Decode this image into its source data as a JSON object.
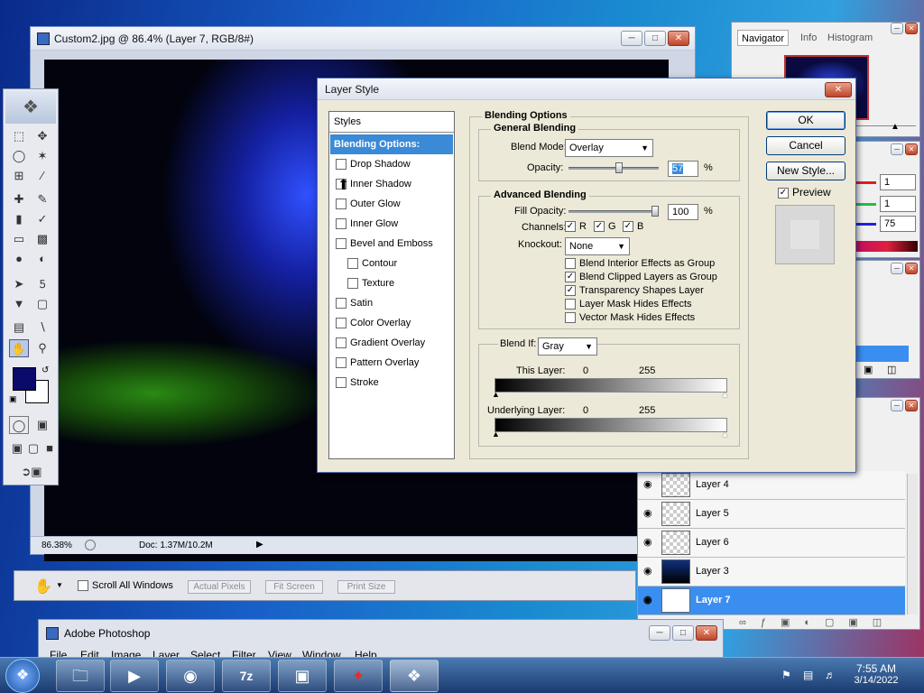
{
  "image_window": {
    "title": "Custom2.jpg @ 86.4% (Layer 7, RGB/8#)",
    "zoom": "86.38%",
    "doc_size": "Doc: 1.37M/10.2M"
  },
  "dialog": {
    "title": "Layer Style",
    "styles_header": "Styles",
    "styles": [
      {
        "label": "Blending Options: Custom",
        "selected": true,
        "checkbox": false,
        "indent": false
      },
      {
        "label": "Drop Shadow",
        "selected": false,
        "checkbox": true,
        "indent": false
      },
      {
        "label": "Inner Shadow",
        "selected": false,
        "checkbox": true,
        "indent": false
      },
      {
        "label": "Outer Glow",
        "selected": false,
        "checkbox": true,
        "indent": false
      },
      {
        "label": "Inner Glow",
        "selected": false,
        "checkbox": true,
        "indent": false
      },
      {
        "label": "Bevel and Emboss",
        "selected": false,
        "checkbox": true,
        "indent": false
      },
      {
        "label": "Contour",
        "selected": false,
        "checkbox": true,
        "indent": true
      },
      {
        "label": "Texture",
        "selected": false,
        "checkbox": true,
        "indent": true
      },
      {
        "label": "Satin",
        "selected": false,
        "checkbox": true,
        "indent": false
      },
      {
        "label": "Color Overlay",
        "selected": false,
        "checkbox": true,
        "indent": false
      },
      {
        "label": "Gradient Overlay",
        "selected": false,
        "checkbox": true,
        "indent": false
      },
      {
        "label": "Pattern Overlay",
        "selected": false,
        "checkbox": true,
        "indent": false
      },
      {
        "label": "Stroke",
        "selected": false,
        "checkbox": true,
        "indent": false
      }
    ],
    "blending_options_label": "Blending Options",
    "general_blending_label": "General Blending",
    "blend_mode_label": "Blend Mode:",
    "blend_mode_value": "Overlay",
    "opacity_label": "Opacity:",
    "opacity_value": "57",
    "opacity_fraction": 0.57,
    "percent": "%",
    "advanced_blending_label": "Advanced Blending",
    "fill_opacity_label": "Fill Opacity:",
    "fill_opacity_value": "100",
    "fill_opacity_fraction": 1.0,
    "channels_label": "Channels:",
    "channel_r": "R",
    "channel_g": "G",
    "channel_b": "B",
    "knockout_label": "Knockout:",
    "knockout_value": "None",
    "options": [
      {
        "label": "Blend Interior Effects as Group",
        "checked": false
      },
      {
        "label": "Blend Clipped Layers as Group",
        "checked": true
      },
      {
        "label": "Transparency Shapes Layer",
        "checked": true
      },
      {
        "label": "Layer Mask Hides Effects",
        "checked": false
      },
      {
        "label": "Vector Mask Hides Effects",
        "checked": false
      }
    ],
    "blend_if_label": "Blend If:",
    "blend_if_value": "Gray",
    "this_layer_label": "This Layer:",
    "underlying_layer_label": "Underlying Layer:",
    "range_min": "0",
    "range_max": "255",
    "ok_label": "OK",
    "cancel_label": "Cancel",
    "new_style_label": "New Style...",
    "preview_label": "Preview"
  },
  "navigator_panel": {
    "tabs": [
      "Navigator",
      "Info",
      "Histogram"
    ]
  },
  "color_panel": {
    "r": "1",
    "g": "1",
    "b": "75"
  },
  "layers_panel": {
    "layers": [
      {
        "name": "Layer 4",
        "selected": false
      },
      {
        "name": "Layer 5",
        "selected": false
      },
      {
        "name": "Layer 6",
        "selected": false
      },
      {
        "name": "Layer 3",
        "selected": false
      },
      {
        "name": "Layer 7",
        "selected": true
      }
    ]
  },
  "options_bar": {
    "scroll_all_label": "Scroll All Windows",
    "actual_pixels_label": "Actual Pixels",
    "fit_screen_label": "Fit Screen",
    "print_size_label": "Print Size"
  },
  "app_window": {
    "title": "Adobe Photoshop",
    "menu": [
      "File",
      "Edit",
      "Image",
      "Layer",
      "Select",
      "Filter",
      "View",
      "Window",
      "Help"
    ]
  },
  "taskbar": {
    "time": "7:55 AM",
    "date": "3/14/2022"
  },
  "colors": {
    "selection_blue": "#3a8ad8",
    "foreground_color": "#0a0a6a"
  }
}
